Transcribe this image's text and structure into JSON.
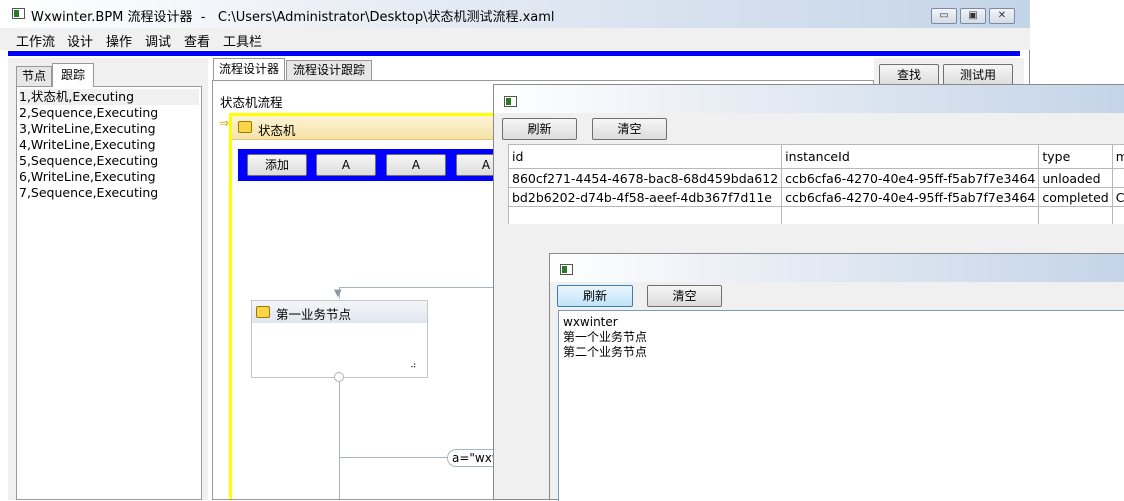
{
  "main_window": {
    "title": "Wxwinter.BPM 流程设计器  -   C:\\Users\\Administrator\\Desktop\\状态机测试流程.xaml",
    "caption_buttons": [
      "minimize-icon",
      "maximize-icon",
      "close-icon"
    ],
    "menu": [
      "工作流",
      "设计",
      "操作",
      "调试",
      "查看",
      "工具栏"
    ],
    "accent_color": "#0000ff"
  },
  "left_panel": {
    "tabs": [
      "节点",
      "跟踪"
    ],
    "active_tab": "跟踪",
    "items": [
      "1,状态机,Executing",
      "2,Sequence,Executing",
      "3,WriteLine,Executing",
      "4,WriteLine,Executing",
      "5,Sequence,Executing",
      "6,WriteLine,Executing",
      "7,Sequence,Executing"
    ]
  },
  "designer": {
    "tabs": [
      "流程设计器",
      "流程设计跟踪"
    ],
    "active_tab": "流程设计器",
    "breadcrumb": "状态机流程",
    "state_machine": {
      "title": "状态机",
      "buttons": [
        "添加",
        "A",
        "A",
        "A"
      ],
      "highlight_color": "#ffff00"
    },
    "state_node": {
      "title": "第一业务节点"
    },
    "transition_label": "a=\"wxw"
  },
  "right_buttons": [
    "查找",
    "测试用"
  ],
  "tracking_window": {
    "buttons": [
      "刷新",
      "清空"
    ],
    "columns": [
      "id",
      "instanceId",
      "type",
      "message"
    ],
    "rows": [
      [
        "860cf271-4454-4678-bac8-68d459bda612",
        "ccb6cfa6-4270-40e4-95ff-f5ab7f7e3464",
        "unloaded",
        ""
      ],
      [
        "bd2b6202-d74b-4f58-aeef-4db367f7d11e",
        "ccb6cfa6-4270-40e4-95ff-f5ab7f7e3464",
        "completed",
        "Closed"
      ]
    ]
  },
  "output_window": {
    "buttons": [
      "刷新",
      "清空"
    ],
    "lines": [
      "wxwinter",
      "第一个业务节点",
      "第二个业务节点"
    ]
  }
}
